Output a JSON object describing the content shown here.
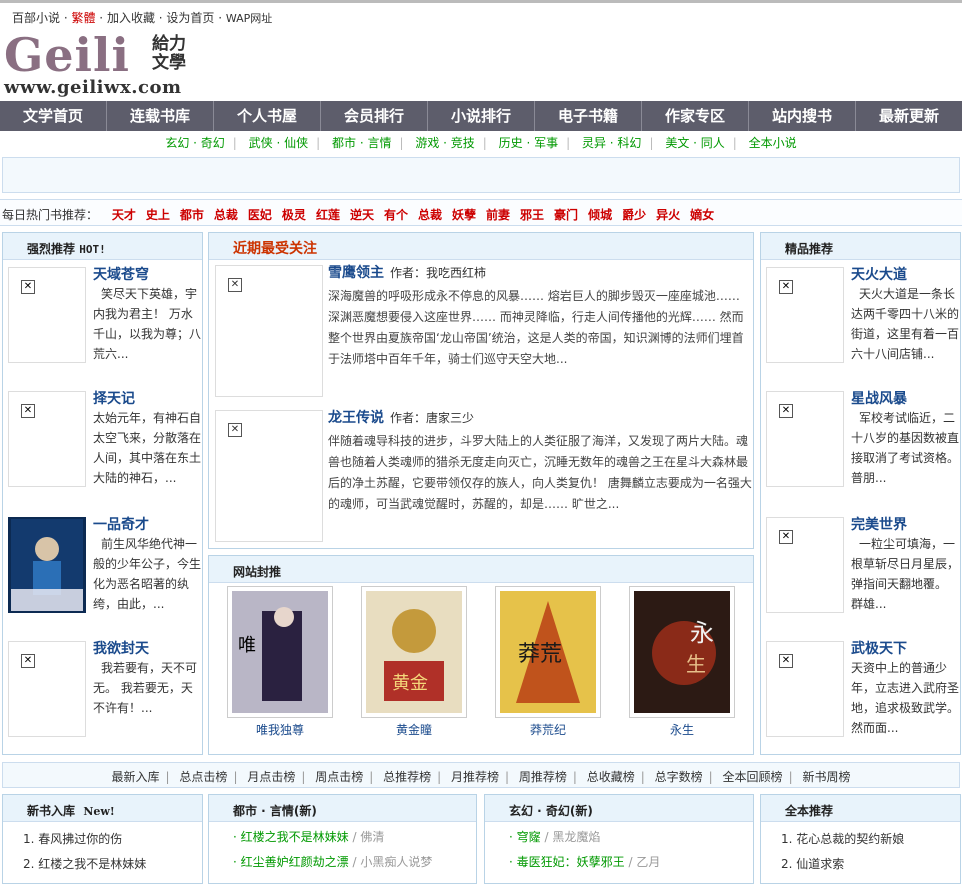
{
  "topbar": {
    "home": "百部小说",
    "trad": "繁體",
    "fav": "加入收藏",
    "sethome": "设为首页",
    "wap": "WAP网址"
  },
  "logo": {
    "brand": "Geili",
    "cn": "給力文學",
    "url": "www.geiliwx.com"
  },
  "nav": [
    "文学首页",
    "连载书库",
    "个人书屋",
    "会员排行",
    "小说排行",
    "电子书籍",
    "作家专区",
    "站内搜书",
    "最新更新"
  ],
  "subnav": [
    "玄幻 · 奇幻",
    "武侠 · 仙侠",
    "都市 · 言情",
    "游戏 · 竞技",
    "历史 · 军事",
    "灵异 · 科幻",
    "美文 · 同人",
    "全本小说"
  ],
  "hot": {
    "label": "每日热门书推荐：",
    "words": [
      "天才",
      "史上",
      "都市",
      "总裁",
      "医妃",
      "极灵",
      "红莲",
      "逆天",
      "有个",
      "总裁",
      "妖孽",
      "前妻",
      "邪王",
      "豪门",
      "倾城",
      "爵少",
      "异火",
      "嫡女"
    ]
  },
  "left": {
    "title": "强烈推荐",
    "tag": "HOT!",
    "items": [
      {
        "title": "天域苍穹",
        "desc": "笑尽天下英雄，宇内我为君主！ 万水千山，以我为尊；八荒六..."
      },
      {
        "title": "择天记",
        "desc": "太始元年，有神石自太空飞来，分散落在人间，其中落在东土大陆的神石，..."
      },
      {
        "title": "一品奇才",
        "desc": "前生风华绝代神一般的少年公子，今生化为恶名昭著的纨绔，由此，..."
      },
      {
        "title": "我欲封天",
        "desc": "我若要有，天不可无。 我若要无，天不许有！..."
      }
    ]
  },
  "middle": {
    "title": "近期最受关注",
    "author_label": "作者：",
    "items": [
      {
        "title": "雪鹰领主",
        "author": "我吃西红柿",
        "desc": "深海魔兽的呼吸形成永不停息的风暴…… 熔岩巨人的脚步毁灭一座座城池…… 深渊恶魔想要侵入这座世界…… 而神灵降临，行走人间传播他的光辉…… 然而整个世界由夏族帝国‘龙山帝国’统治，这是人类的帝国，知识渊博的法师们埋首于法师塔中百年千年，骑士们巡守天空大地..."
      },
      {
        "title": "龙王传说",
        "author": "唐家三少",
        "desc": "伴随着魂导科技的进步，斗罗大陆上的人类征服了海洋，又发现了两片大陆。魂兽也随着人类魂师的猎杀无度走向灭亡，沉睡无数年的魂兽之王在星斗大森林最后的净土苏醒，它要带领仅存的族人，向人类复仇！ 唐舞麟立志要成为一名强大的魂师，可当武魂觉醒时，苏醒的，却是…… 旷世之..."
      }
    ]
  },
  "feature": {
    "title": "网站封推",
    "covers": [
      "唯我独尊",
      "黄金瞳",
      "莽荒纪",
      "永生"
    ]
  },
  "right": {
    "title": "精品推荐",
    "items": [
      {
        "title": "天火大道",
        "desc": "天火大道是一条长达两千零四十八米的街道，这里有着一百六十八间店铺..."
      },
      {
        "title": "星战风暴",
        "desc": "军校考试临近，二十八岁的基因数被直接取消了考试资格。 普朋..."
      },
      {
        "title": "完美世界",
        "desc": "一粒尘可填海，一根草斩尽日月星辰，弹指间天翻地覆。 群雄..."
      },
      {
        "title": "武极天下",
        "desc": "天资中上的普通少年，立志进入武府圣地，追求极致武学。然而面..."
      }
    ]
  },
  "rankbar": [
    "最新入库",
    "总点击榜",
    "月点击榜",
    "周点击榜",
    "总推荐榜",
    "月推荐榜",
    "周推荐榜",
    "总收藏榜",
    "总字数榜",
    "全本回顾榜",
    "新书周榜"
  ],
  "newbooks": {
    "title": "新书入库",
    "tag": "New!",
    "items": [
      "1.  春风拂过你的伤",
      "2.  红楼之我不是林妹妹"
    ]
  },
  "city": {
    "title": "都市 · 言情(新)",
    "items": [
      {
        "t": "红楼之我不是林妹妹",
        "a": "/ 佛清"
      },
      {
        "t": "红尘善妒红颜劫之漂",
        "a": "/ 小黑痴人说梦"
      }
    ]
  },
  "fantasy": {
    "title": "玄幻 · 奇幻(新)",
    "items": [
      {
        "t": "穹窿",
        "a": "/ 黑龙魔焰"
      },
      {
        "t": "毒医狂妃：妖孽邪王",
        "a": "/ 乙月"
      }
    ]
  },
  "full": {
    "title": "全本推荐",
    "items": [
      "1.  花心总裁的契约新娘",
      "2.  仙道求索"
    ]
  }
}
